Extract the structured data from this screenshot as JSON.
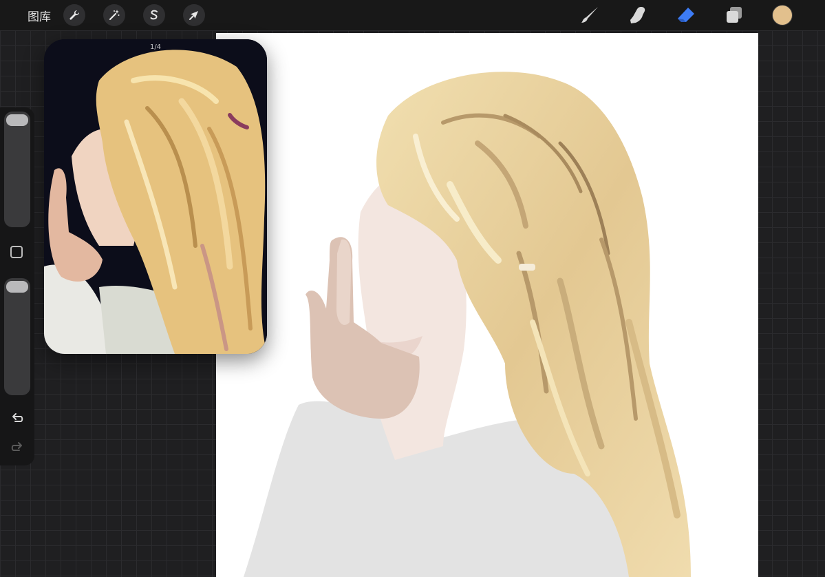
{
  "topbar": {
    "gallery_label": "图库",
    "left_tools": [
      {
        "name": "actions",
        "icon": "wrench-icon"
      },
      {
        "name": "adjustments",
        "icon": "magic-wand-icon"
      },
      {
        "name": "selection",
        "icon": "selection-s-icon"
      },
      {
        "name": "transform",
        "icon": "arrow-cursor-icon"
      }
    ],
    "right_tools": [
      {
        "name": "brush",
        "icon": "brush-icon",
        "active": false
      },
      {
        "name": "smudge",
        "icon": "smudge-finger-icon",
        "active": false
      },
      {
        "name": "eraser",
        "icon": "eraser-icon",
        "active": true
      },
      {
        "name": "layers",
        "icon": "layers-icon",
        "active": false
      }
    ],
    "current_color": "#e2c08d",
    "active_tool_color": "#3d7cf5"
  },
  "reference": {
    "counter": "1/4"
  },
  "sidebar": {
    "brush_size_level": 0.0,
    "opacity_level": 0.0,
    "icons": [
      "modifier-square-icon",
      "undo-icon",
      "redo-icon"
    ]
  },
  "colors": {
    "hair_light": "#f3e2b4",
    "hair_mid": "#e1c68e",
    "hair_dark": "#b7996a",
    "skin": "#f3e6e0",
    "hand": "#dcc2b4",
    "sweater": "#e3e3e3"
  }
}
